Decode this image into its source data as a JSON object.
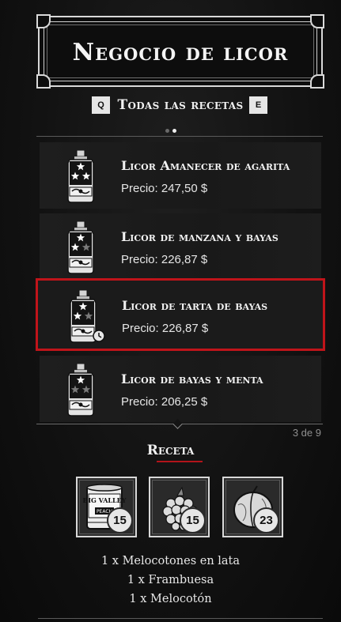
{
  "header": {
    "title": "Negocio de licor"
  },
  "category": {
    "prev_key": "Q",
    "next_key": "E",
    "label": "Todas las recetas",
    "pages": 2,
    "active_page": 2
  },
  "items": [
    {
      "name": "Licor Amanecer de agarita",
      "price": "Precio: 247,50 $",
      "stars_filled": 3,
      "selected": false
    },
    {
      "name": "Licor de manzana y bayas",
      "price": "Precio: 226,87 $",
      "stars_filled": 2,
      "selected": false
    },
    {
      "name": "Licor de tarta de bayas",
      "price": "Precio: 226,87 $",
      "stars_filled": 2,
      "selected": true,
      "icon_badge": "clock-icon"
    },
    {
      "name": "Licor de bayas y menta",
      "price": "Precio: 206,25 $",
      "stars_filled": 1,
      "selected": false
    }
  ],
  "page_indicator": "3 de 9",
  "recipe": {
    "title": "Receta",
    "ingredients": [
      {
        "icon": "canned-peaches-icon",
        "count": "15",
        "label": "BIG VALLEY",
        "sublabel": "PEACH"
      },
      {
        "icon": "raspberry-icon",
        "count": "15"
      },
      {
        "icon": "peach-icon",
        "count": "23"
      }
    ],
    "lines": [
      "1 x Melocotones en lata",
      "1 x Frambuesa",
      "1 x Melocotón"
    ]
  },
  "colors": {
    "accent": "#c0141a",
    "text": "#f2f2f2",
    "background": "#121212"
  }
}
